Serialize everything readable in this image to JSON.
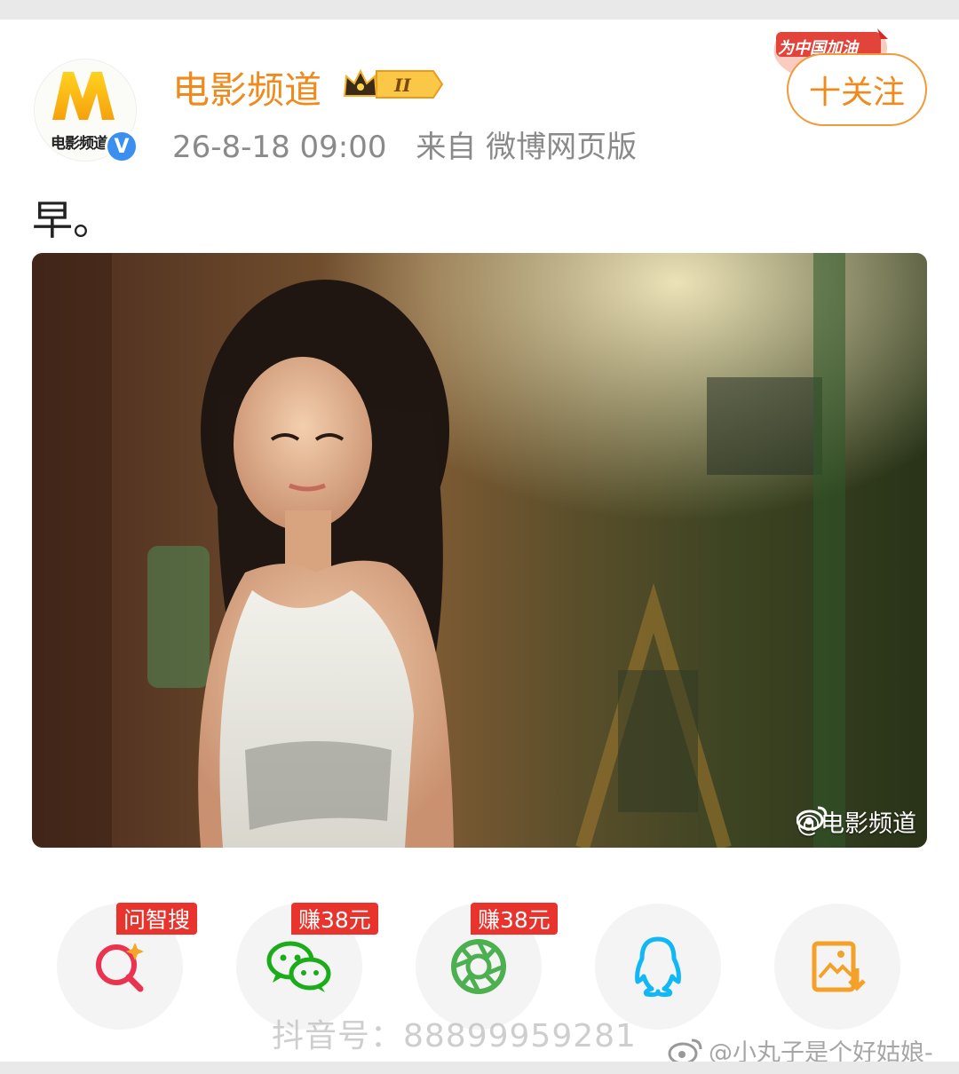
{
  "post": {
    "user_name": "电影频道",
    "avatar_text": "电影频道",
    "level_badge": "II",
    "timestamp": "26-8-18 09:00",
    "source": "来自 微博网页版",
    "follow_label": "十关注",
    "campaign_badge": "为中国加油",
    "text": "早。",
    "photo_watermark": "@电影频道"
  },
  "share": {
    "items": [
      {
        "name": "wenzhisou",
        "tag": "问智搜",
        "icon": "search-sparkle-icon"
      },
      {
        "name": "wechat",
        "tag": "赚38元",
        "icon": "wechat-icon"
      },
      {
        "name": "moments",
        "tag": "赚38元",
        "icon": "moments-icon"
      },
      {
        "name": "qq",
        "tag": "",
        "icon": "qq-icon"
      },
      {
        "name": "save-image",
        "tag": "",
        "icon": "save-image-icon"
      }
    ]
  },
  "watermarks": {
    "douyin": "抖音号：88899959281",
    "weibo_user": "@小丸子是个好姑娘-"
  },
  "colors": {
    "brand_orange": "#f08a1c",
    "tag_red": "#e8342c",
    "verified_blue": "#3a8ff0",
    "wechat_green": "#1aad19",
    "qq_blue": "#12b7f5"
  }
}
